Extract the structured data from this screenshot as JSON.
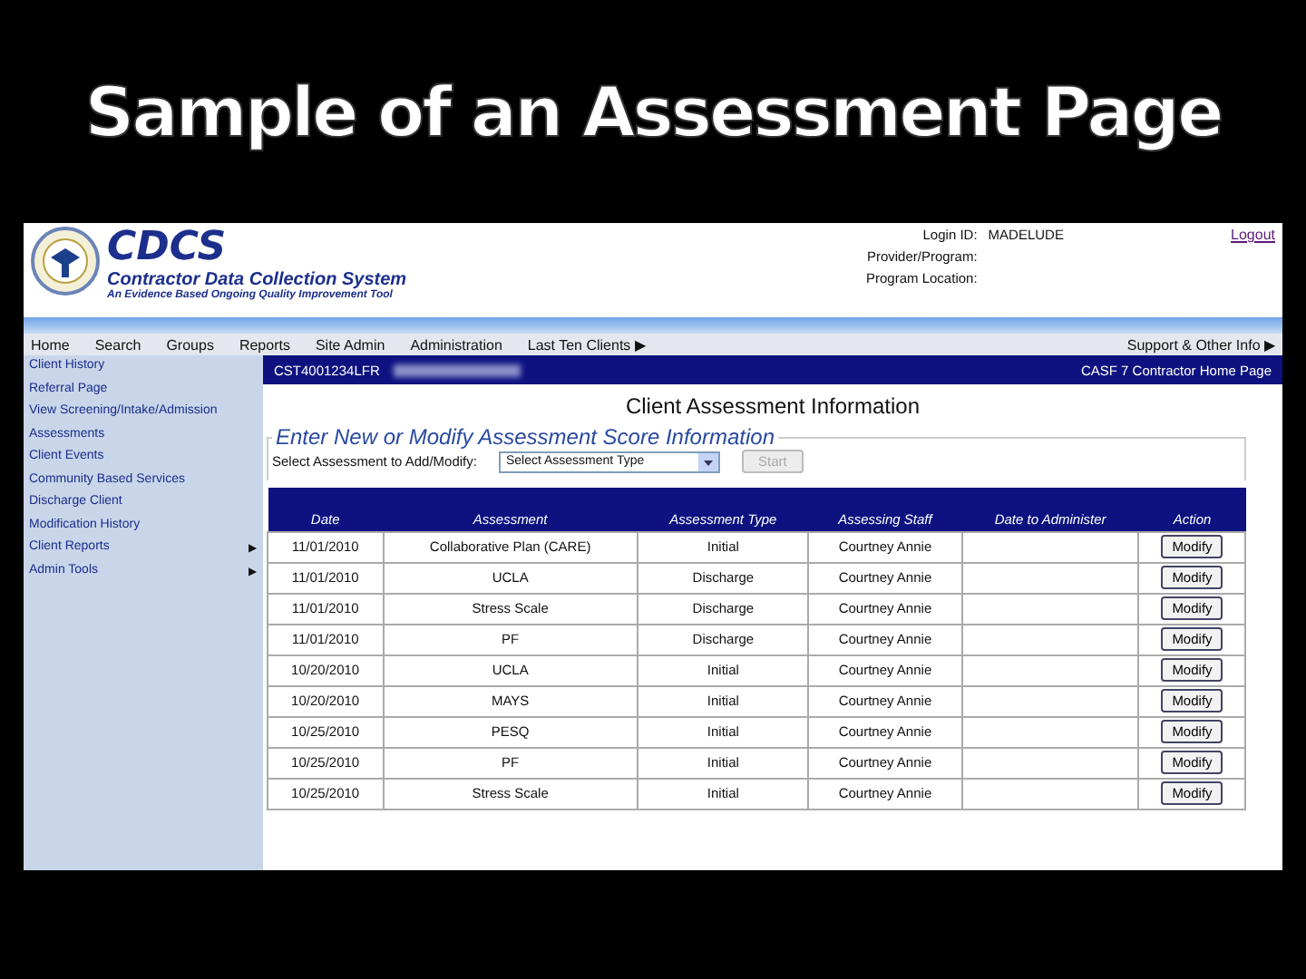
{
  "slide_title": "Sample of an Assessment Page",
  "header": {
    "logo_text": "CDCS",
    "system_name": "Contractor Data Collection System",
    "tagline": "An Evidence Based Ongoing Quality Improvement Tool",
    "login": [
      {
        "label": "Login ID:",
        "value": "MADELUDE"
      },
      {
        "label": "Provider/Program:"
      },
      {
        "label": "Program Location:"
      }
    ],
    "logout": "Logout"
  },
  "nav": [
    {
      "label": "Home"
    },
    {
      "label": "Search"
    },
    {
      "label": "Groups"
    },
    {
      "label": "Reports"
    },
    {
      "label": "Site Admin"
    },
    {
      "label": "Administration"
    },
    {
      "label": "Last Ten Clients",
      "arrow": "▶"
    }
  ],
  "nav_right": {
    "label": "Support & Other Info",
    "arrow": "▶"
  },
  "sidebar": {
    "items": [
      {
        "label": "Client History"
      },
      {
        "label": "Referral Page"
      },
      {
        "label": "View Screening/Intake/Admission"
      },
      {
        "label": "Assessments"
      },
      {
        "label": "Client Events"
      },
      {
        "label": "Community Based Services"
      },
      {
        "label": "Discharge Client"
      },
      {
        "label": "Modification History"
      },
      {
        "label": "Client Reports",
        "arrow": "▶"
      },
      {
        "label": "Admin Tools",
        "arrow": "▶"
      }
    ]
  },
  "client_bar": {
    "client_id": "CST4001234LFR",
    "page": "CASF 7 Contractor Home Page"
  },
  "page_title": "Client Assessment Information",
  "fieldset": {
    "legend": "Enter New or Modify Assessment Score Information",
    "select_label": "Select Assessment to Add/Modify:",
    "select_value": "Select Assessment Type",
    "start_button": {
      "label": "Start",
      "disabled": true
    }
  },
  "table": {
    "columns": [
      "Date",
      "Assessment",
      "Assessment Type",
      "Assessing Staff",
      "Date to Administer",
      "Action"
    ],
    "rows": [
      {
        "date": "11/01/2010",
        "assessment": "Collaborative Plan (CARE)",
        "type": "Initial",
        "staff": "Courtney Annie",
        "action": "Modify"
      },
      {
        "date": "11/01/2010",
        "assessment": "UCLA",
        "type": "Discharge",
        "staff": "Courtney Annie",
        "action": "Modify"
      },
      {
        "date": "11/01/2010",
        "assessment": "Stress Scale",
        "type": "Discharge",
        "staff": "Courtney Annie",
        "action": "Modify"
      },
      {
        "date": "11/01/2010",
        "assessment": "PF",
        "type": "Discharge",
        "staff": "Courtney Annie",
        "action": "Modify"
      },
      {
        "date": "10/20/2010",
        "assessment": "UCLA",
        "type": "Initial",
        "staff": "Courtney Annie",
        "action": "Modify"
      },
      {
        "date": "10/20/2010",
        "assessment": "MAYS",
        "type": "Initial",
        "staff": "Courtney Annie",
        "action": "Modify"
      },
      {
        "date": "10/25/2010",
        "assessment": "PESQ",
        "type": "Initial",
        "staff": "Courtney Annie",
        "action": "Modify"
      },
      {
        "date": "10/25/2010",
        "assessment": "PF",
        "type": "Initial",
        "staff": "Courtney Annie",
        "action": "Modify"
      },
      {
        "date": "10/25/2010",
        "assessment": "Stress Scale",
        "type": "Initial",
        "staff": "Courtney Annie",
        "action": "Modify"
      }
    ]
  }
}
